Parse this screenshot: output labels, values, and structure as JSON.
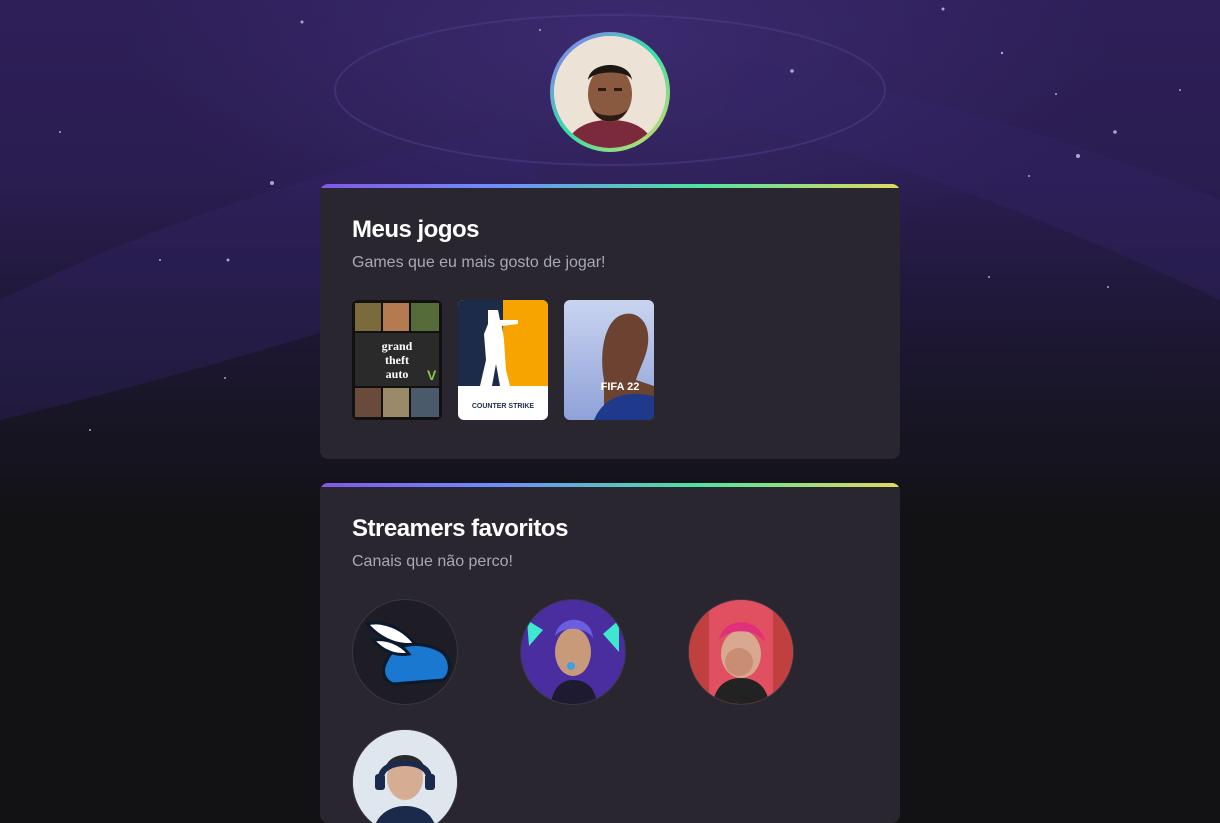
{
  "profile": {
    "avatar_alt": "foto de perfil"
  },
  "games_section": {
    "title": "Meus jogos",
    "subtitle": "Games que eu mais gosto de jogar!",
    "games": [
      {
        "name": "GTA V",
        "cover_text": "grand theft auto"
      },
      {
        "name": "Counter Strike",
        "cover_text": "COUNTER STRIKE"
      },
      {
        "name": "FIFA 22",
        "cover_text": "FIFA 22"
      }
    ]
  },
  "streamers_section": {
    "title": "Streamers favoritos",
    "subtitle": "Canais que não perco!"
  },
  "colors": {
    "background": "#121214",
    "card": "#29262f",
    "gradient": [
      "#8257e5",
      "#4ee3a0",
      "#e1d95e"
    ]
  }
}
